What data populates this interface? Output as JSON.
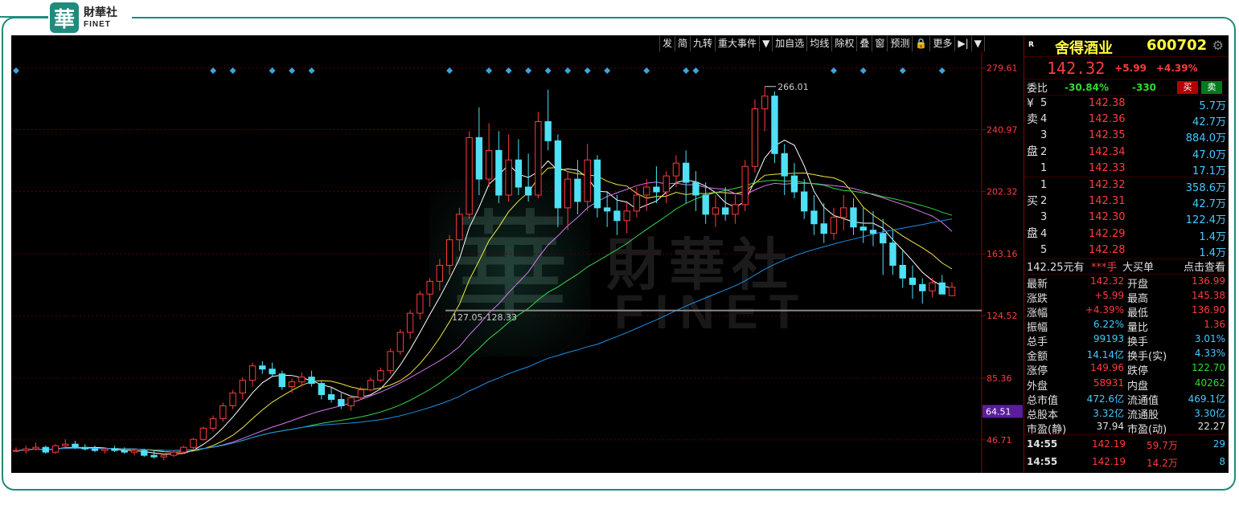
{
  "brand": {
    "logo_glyph": "華",
    "name_cn": "財華社",
    "name_en": "FINET"
  },
  "toolbar": [
    {
      "name": "tb-fa",
      "label": "发"
    },
    {
      "name": "tb-jian",
      "label": "简"
    },
    {
      "name": "tb-jiuzhuan",
      "label": "九转"
    },
    {
      "name": "tb-events",
      "label": "重大事件"
    },
    {
      "name": "tb-dropdown",
      "label": "▼"
    },
    {
      "name": "tb-add-watch",
      "label": "加自选"
    },
    {
      "name": "tb-fenxian",
      "label": "均线"
    },
    {
      "name": "tb-fuquan",
      "label": "除权"
    },
    {
      "name": "tb-overlay",
      "label": "叠"
    },
    {
      "name": "tb-window",
      "label": "窗"
    },
    {
      "name": "tb-forecast",
      "label": "预测"
    },
    {
      "name": "tb-lock",
      "label": "🔒"
    },
    {
      "name": "tb-more",
      "label": "更多"
    },
    {
      "name": "tb-arrow",
      "label": "▶|"
    },
    {
      "name": "tb-menu",
      "label": "▼"
    }
  ],
  "colors": {
    "up": "#ff3b3b",
    "down": "#4fe0f4",
    "ma5": "#ffffff",
    "ma10": "#f2e640",
    "ma20": "#d479f0",
    "ma30": "#39d64a",
    "ma60": "#1e8fe8",
    "axis_text": "#ff3b3b",
    "highlight_label_bg": "#5a1e9c"
  },
  "chart_data": {
    "type": "candlestick",
    "y_ticks": [
      "279.61",
      "240.97",
      "202.32",
      "163.16",
      "124.52",
      "85.36",
      "46.71"
    ],
    "ylim": [
      26,
      290
    ],
    "highlight_label": "64.51",
    "annotations": {
      "high": "266.01",
      "low_range": "127.05-128.33"
    },
    "ref_line": 127.7,
    "event_marker_indices": [
      0,
      20,
      22,
      26,
      28,
      30,
      44,
      48,
      50,
      52,
      54,
      56,
      58,
      60,
      64,
      68,
      69,
      83,
      86,
      90,
      94
    ],
    "ohlc": [
      [
        40,
        42,
        39,
        40
      ],
      [
        40,
        43,
        38,
        41
      ],
      [
        41,
        45,
        40,
        42
      ],
      [
        42,
        43,
        38,
        39
      ],
      [
        39,
        44,
        38,
        43
      ],
      [
        43,
        47,
        42,
        44
      ],
      [
        44,
        46,
        41,
        42
      ],
      [
        42,
        44,
        40,
        41
      ],
      [
        41,
        43,
        39,
        40
      ],
      [
        40,
        42,
        38,
        41
      ],
      [
        41,
        43,
        39,
        40
      ],
      [
        40,
        42,
        38,
        39
      ],
      [
        39,
        41,
        37,
        40
      ],
      [
        40,
        41,
        36,
        37
      ],
      [
        37,
        40,
        35,
        36
      ],
      [
        36,
        38,
        34,
        37
      ],
      [
        37,
        40,
        36,
        39
      ],
      [
        39,
        43,
        38,
        42
      ],
      [
        42,
        48,
        41,
        47
      ],
      [
        47,
        55,
        46,
        54
      ],
      [
        54,
        62,
        52,
        60
      ],
      [
        60,
        70,
        58,
        68
      ],
      [
        68,
        78,
        66,
        76
      ],
      [
        76,
        86,
        72,
        84
      ],
      [
        84,
        95,
        80,
        93
      ],
      [
        93,
        96,
        88,
        91
      ],
      [
        91,
        95,
        86,
        88
      ],
      [
        88,
        90,
        78,
        80
      ],
      [
        80,
        85,
        76,
        83
      ],
      [
        83,
        89,
        80,
        86
      ],
      [
        86,
        90,
        80,
        82
      ],
      [
        82,
        84,
        72,
        75
      ],
      [
        75,
        80,
        70,
        72
      ],
      [
        72,
        76,
        66,
        68
      ],
      [
        68,
        74,
        65,
        73
      ],
      [
        73,
        80,
        72,
        78
      ],
      [
        78,
        86,
        77,
        84
      ],
      [
        84,
        92,
        83,
        90
      ],
      [
        90,
        104,
        88,
        102
      ],
      [
        102,
        116,
        100,
        114
      ],
      [
        114,
        128,
        110,
        126
      ],
      [
        126,
        140,
        122,
        138
      ],
      [
        138,
        148,
        130,
        146
      ],
      [
        146,
        160,
        140,
        156
      ],
      [
        156,
        175,
        150,
        172
      ],
      [
        172,
        192,
        165,
        188
      ],
      [
        188,
        240,
        185,
        236
      ],
      [
        236,
        255,
        200,
        210
      ],
      [
        210,
        245,
        205,
        228
      ],
      [
        228,
        240,
        195,
        200
      ],
      [
        200,
        238,
        196,
        222
      ],
      [
        222,
        235,
        200,
        205
      ],
      [
        205,
        226,
        196,
        200
      ],
      [
        200,
        252,
        198,
        246
      ],
      [
        246,
        266,
        228,
        234
      ],
      [
        234,
        238,
        180,
        192
      ],
      [
        192,
        215,
        178,
        210
      ],
      [
        210,
        222,
        188,
        196
      ],
      [
        196,
        232,
        190,
        222
      ],
      [
        222,
        225,
        186,
        192
      ],
      [
        192,
        202,
        180,
        190
      ],
      [
        190,
        200,
        175,
        184
      ],
      [
        184,
        195,
        176,
        190
      ],
      [
        190,
        205,
        186,
        200
      ],
      [
        200,
        210,
        190,
        205
      ],
      [
        205,
        218,
        195,
        202
      ],
      [
        202,
        215,
        195,
        212
      ],
      [
        212,
        225,
        205,
        220
      ],
      [
        220,
        228,
        195,
        208
      ],
      [
        208,
        215,
        190,
        200
      ],
      [
        200,
        208,
        182,
        188
      ],
      [
        188,
        200,
        180,
        192
      ],
      [
        192,
        205,
        184,
        188
      ],
      [
        188,
        200,
        182,
        194
      ],
      [
        194,
        222,
        190,
        218
      ],
      [
        218,
        260,
        214,
        254
      ],
      [
        254,
        268,
        240,
        262
      ],
      [
        262,
        265,
        220,
        226
      ],
      [
        226,
        232,
        200,
        212
      ],
      [
        212,
        220,
        198,
        202
      ],
      [
        202,
        210,
        185,
        190
      ],
      [
        190,
        200,
        175,
        182
      ],
      [
        182,
        195,
        170,
        176
      ],
      [
        176,
        192,
        172,
        186
      ],
      [
        186,
        200,
        178,
        192
      ],
      [
        192,
        198,
        175,
        180
      ],
      [
        180,
        192,
        170,
        178
      ],
      [
        178,
        190,
        168,
        176
      ],
      [
        176,
        185,
        150,
        170
      ],
      [
        170,
        178,
        150,
        156
      ],
      [
        156,
        165,
        142,
        148
      ],
      [
        148,
        156,
        135,
        144
      ],
      [
        144,
        148,
        132,
        140
      ],
      [
        140,
        148,
        136,
        145
      ],
      [
        145,
        150,
        138,
        138
      ],
      [
        136.99,
        145.38,
        136.9,
        142.32
      ]
    ],
    "ma_series": [
      {
        "name": "MA5",
        "period": 5,
        "color": "#ffffff"
      },
      {
        "name": "MA10",
        "period": 10,
        "color": "#f2e640"
      },
      {
        "name": "MA20",
        "period": 20,
        "color": "#d479f0"
      },
      {
        "name": "MA30",
        "period": 30,
        "color": "#39d64a"
      },
      {
        "name": "MA60",
        "period": 60,
        "color": "#1e8fe8"
      }
    ]
  },
  "panel": {
    "r_tag": "R",
    "name": "舍得酒业",
    "code": "600702",
    "last": "142.32",
    "change": "+5.99",
    "pct": "+4.39%",
    "webi_label": "委比",
    "webi_pct": "-30.84%",
    "webi_diff": "-330",
    "buy_btn": "买",
    "sell_btn": "卖",
    "sell_side_label": "¥\n卖\n\n盘\n",
    "sell_levels": [
      {
        "lvl": "5",
        "px": "142.38",
        "vol": "5.7万"
      },
      {
        "lvl": "4",
        "px": "142.36",
        "vol": "42.7万"
      },
      {
        "lvl": "3",
        "px": "142.35",
        "vol": "884.0万"
      },
      {
        "lvl": "2",
        "px": "142.34",
        "vol": "47.0万"
      },
      {
        "lvl": "1",
        "px": "142.33",
        "vol": "17.1万"
      }
    ],
    "buy_levels": [
      {
        "lvl": "1",
        "px": "142.32",
        "vol": "358.6万"
      },
      {
        "lvl": "2",
        "px": "142.31",
        "vol": "42.7万"
      },
      {
        "lvl": "3",
        "px": "142.30",
        "vol": "122.4万"
      },
      {
        "lvl": "4",
        "px": "142.29",
        "vol": "1.4万"
      },
      {
        "lvl": "5",
        "px": "142.28",
        "vol": "1.4万"
      }
    ],
    "side_sell_1": "¥",
    "side_sell_2": "卖",
    "side_sell_3": "盘",
    "side_buy_1": "买",
    "side_buy_2": "盘",
    "notice": {
      "a": "142.25元有",
      "b": "***手",
      "c": "大买单",
      "d": "点击查看"
    },
    "stats": [
      {
        "l1": "最新",
        "v1": "142.32",
        "c1": "#ff3b3b",
        "l2": "开盘",
        "v2": "136.99",
        "c2": "#ff3b3b"
      },
      {
        "l1": "涨跌",
        "v1": "+5.99",
        "c1": "#ff3b3b",
        "l2": "最高",
        "v2": "145.38",
        "c2": "#ff3b3b"
      },
      {
        "l1": "涨幅",
        "v1": "+4.39%",
        "c1": "#ff3b3b",
        "l2": "最低",
        "v2": "136.90",
        "c2": "#ff3b3b"
      },
      {
        "l1": "振幅",
        "v1": "6.22%",
        "c1": "#47c9ff",
        "l2": "量比",
        "v2": "1.36",
        "c2": "#ff3b3b"
      },
      {
        "l1": "总手",
        "v1": "99193",
        "c1": "#47c9ff",
        "l2": "换手",
        "v2": "3.01%",
        "c2": "#47c9ff"
      },
      {
        "l1": "金额",
        "v1": "14.14亿",
        "c1": "#47c9ff",
        "l2": "换手(实)",
        "v2": "4.33%",
        "c2": "#47c9ff"
      },
      {
        "l1": "涨停",
        "v1": "149.96",
        "c1": "#ff3b3b",
        "l2": "跌停",
        "v2": "122.70",
        "c2": "#2ddc2d"
      },
      {
        "l1": "外盘",
        "v1": "58931",
        "c1": "#ff3b3b",
        "l2": "内盘",
        "v2": "40262",
        "c2": "#2ddc2d"
      },
      {
        "l1": "总市值",
        "v1": "472.6亿",
        "c1": "#47c9ff",
        "l2": "流通值",
        "v2": "469.1亿",
        "c2": "#47c9ff"
      },
      {
        "l1": "总股本",
        "v1": "3.32亿",
        "c1": "#47c9ff",
        "l2": "流通股",
        "v2": "3.30亿",
        "c2": "#47c9ff"
      },
      {
        "l1": "市盈(静)",
        "v1": "37.94",
        "c1": "#e0e0e0",
        "l2": "市盈(动)",
        "v2": "22.27",
        "c2": "#e0e0e0"
      }
    ],
    "ticks": [
      {
        "t": "14:55",
        "p": "142.19",
        "v": "59.7万",
        "n": "29"
      },
      {
        "t": "14:55",
        "p": "142.19",
        "v": "14.2万",
        "n": "8"
      }
    ]
  }
}
